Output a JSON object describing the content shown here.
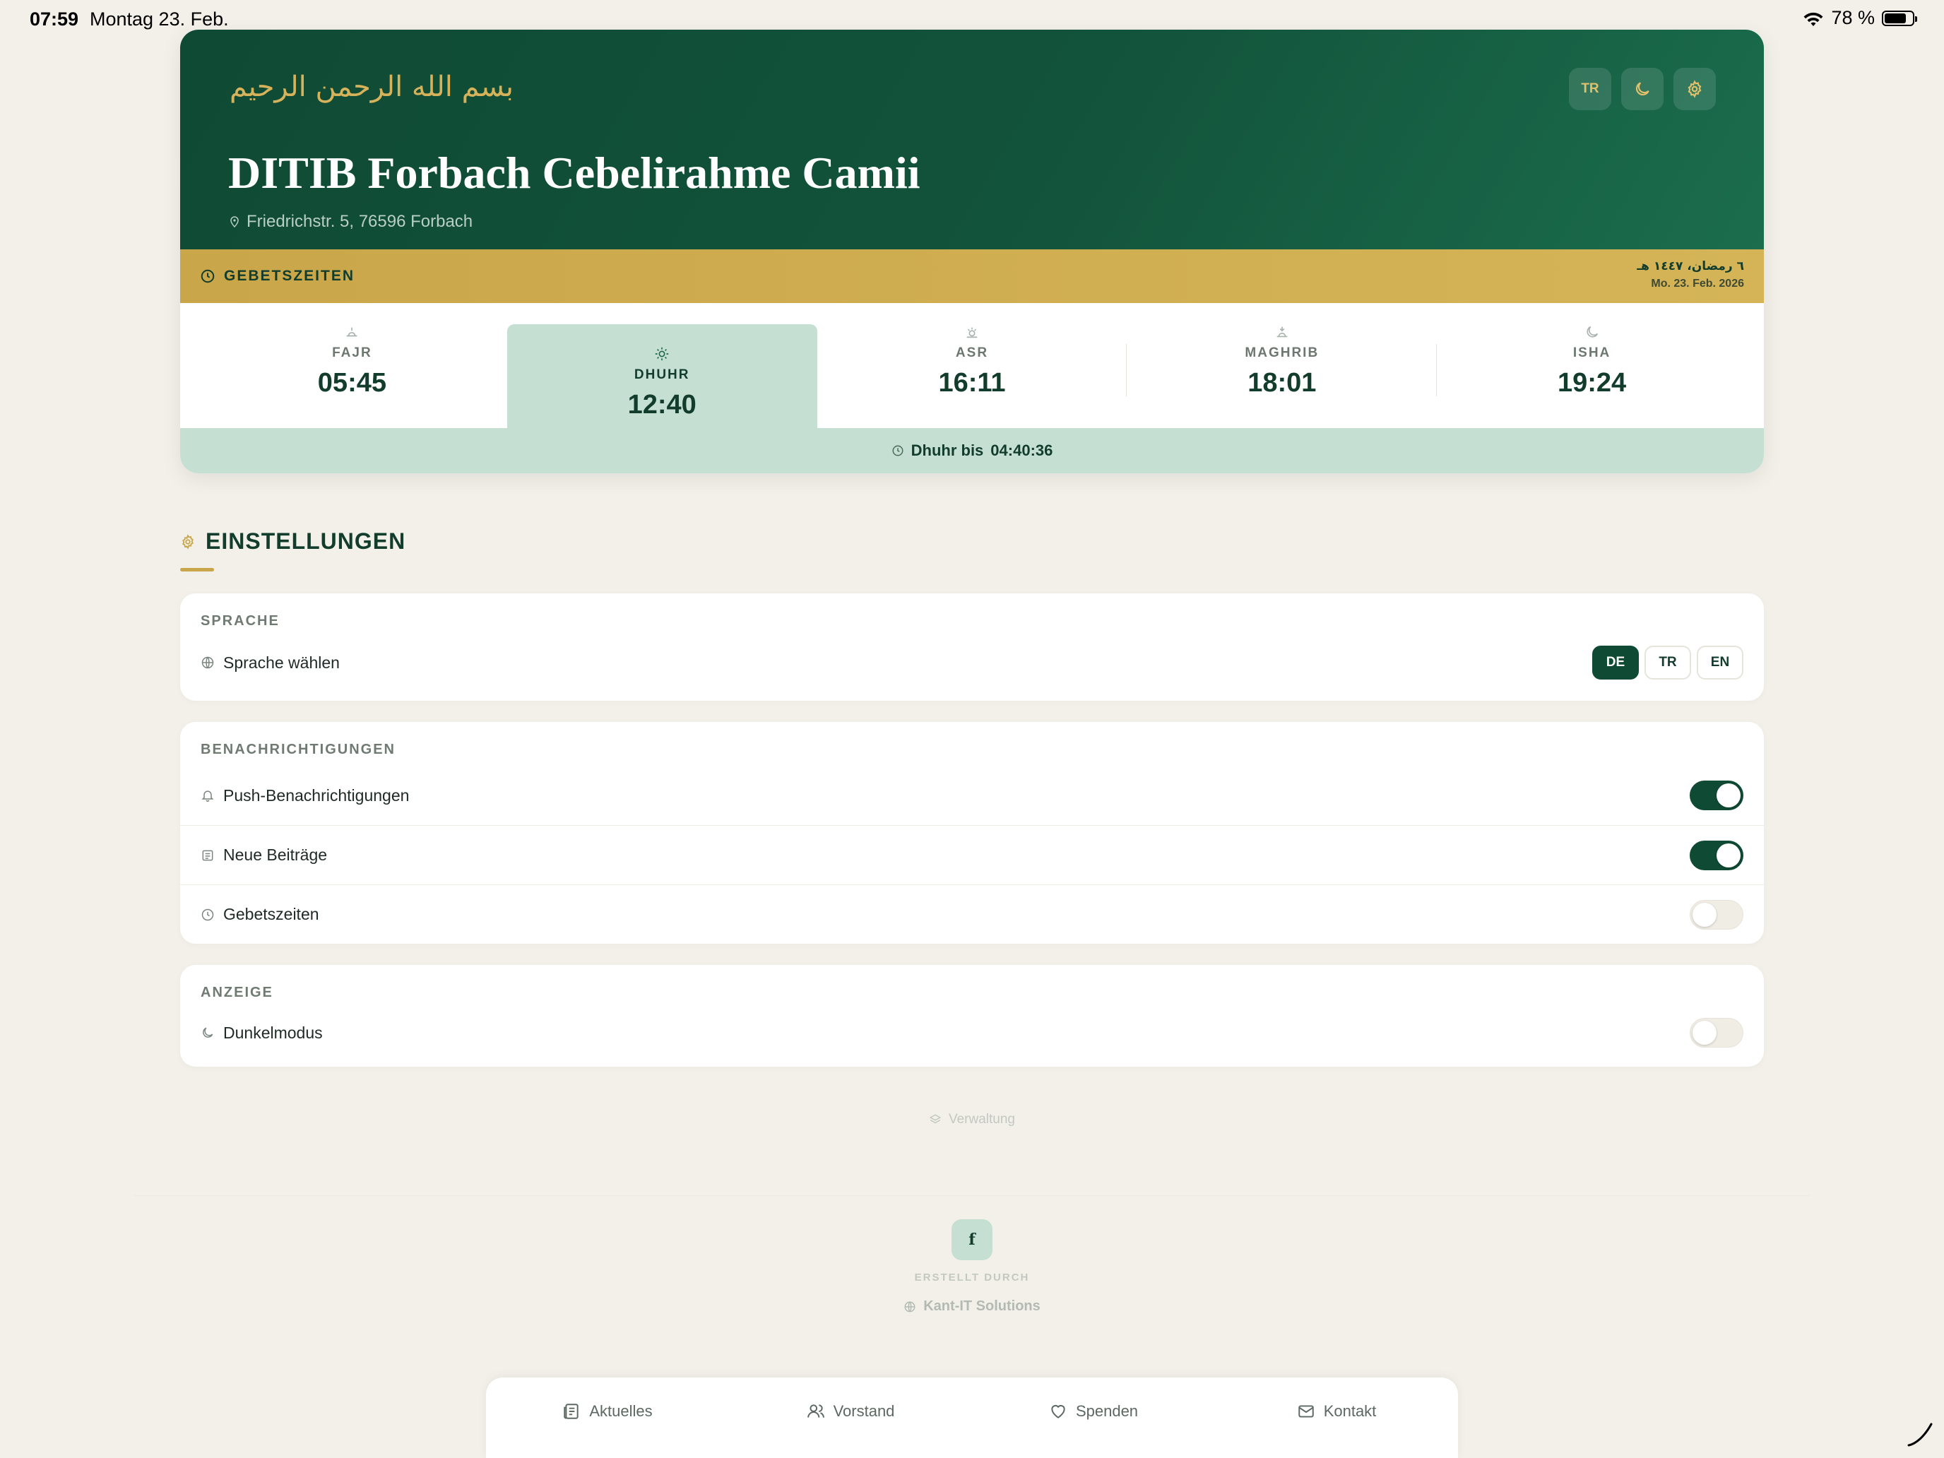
{
  "status_bar": {
    "time": "07:59",
    "date": "Montag 23. Feb.",
    "battery": "78 %",
    "battery_level": 0.78
  },
  "header": {
    "bismillah": "بسم الله الرحمن الرحيم",
    "mosque_name": "DITIB Forbach Cebelirahme Camii",
    "address": "Friedrichstr. 5, 76596 Forbach",
    "lang_button": "TR"
  },
  "prayer_bar": {
    "label": "GEBETSZEITEN",
    "hijri_date": "٦ رمضان، ١٤٤٧ هـ",
    "gregorian_date": "Mo. 23. Feb. 2026"
  },
  "prayers": [
    {
      "name": "FAJR",
      "time": "05:45",
      "icon": "sunrise-icon",
      "active": false
    },
    {
      "name": "DHUHR",
      "time": "12:40",
      "icon": "sun-icon",
      "active": true
    },
    {
      "name": "ASR",
      "time": "16:11",
      "icon": "sun-low-icon",
      "active": false
    },
    {
      "name": "MAGHRIB",
      "time": "18:01",
      "icon": "sunset-icon",
      "active": false
    },
    {
      "name": "ISHA",
      "time": "19:24",
      "icon": "moon-icon",
      "active": false
    }
  ],
  "countdown": {
    "label": "Dhuhr bis",
    "value": "04:40:36"
  },
  "settings": {
    "title": "EINSTELLUNGEN",
    "language": {
      "header": "SPRACHE",
      "row_label": "Sprache wählen",
      "options": [
        "DE",
        "TR",
        "EN"
      ],
      "selected": "DE"
    },
    "notifications": {
      "header": "BENACHRICHTIGUNGEN",
      "rows": [
        {
          "label": "Push-Benachrichtigungen",
          "on": true
        },
        {
          "label": "Neue Beiträge",
          "on": true
        },
        {
          "label": "Gebetszeiten",
          "on": false
        }
      ]
    },
    "display": {
      "header": "ANZEIGE",
      "rows": [
        {
          "label": "Dunkelmodus",
          "on": false
        }
      ]
    }
  },
  "footer": {
    "admin_link": "Verwaltung",
    "facebook_letter": "f",
    "created_by": "ERSTELLT DURCH",
    "company": "Kant-IT Solutions"
  },
  "tabbar": {
    "tabs": [
      {
        "label": "Aktuelles",
        "icon": "newspaper-icon"
      },
      {
        "label": "Vorstand",
        "icon": "users-icon"
      },
      {
        "label": "Spenden",
        "icon": "heart-icon"
      },
      {
        "label": "Kontakt",
        "icon": "mail-icon"
      }
    ]
  },
  "colors": {
    "primary": "#0f4a34",
    "gold": "#c9a649",
    "mint": "#c6dfd3",
    "background": "#f8f6f1"
  }
}
